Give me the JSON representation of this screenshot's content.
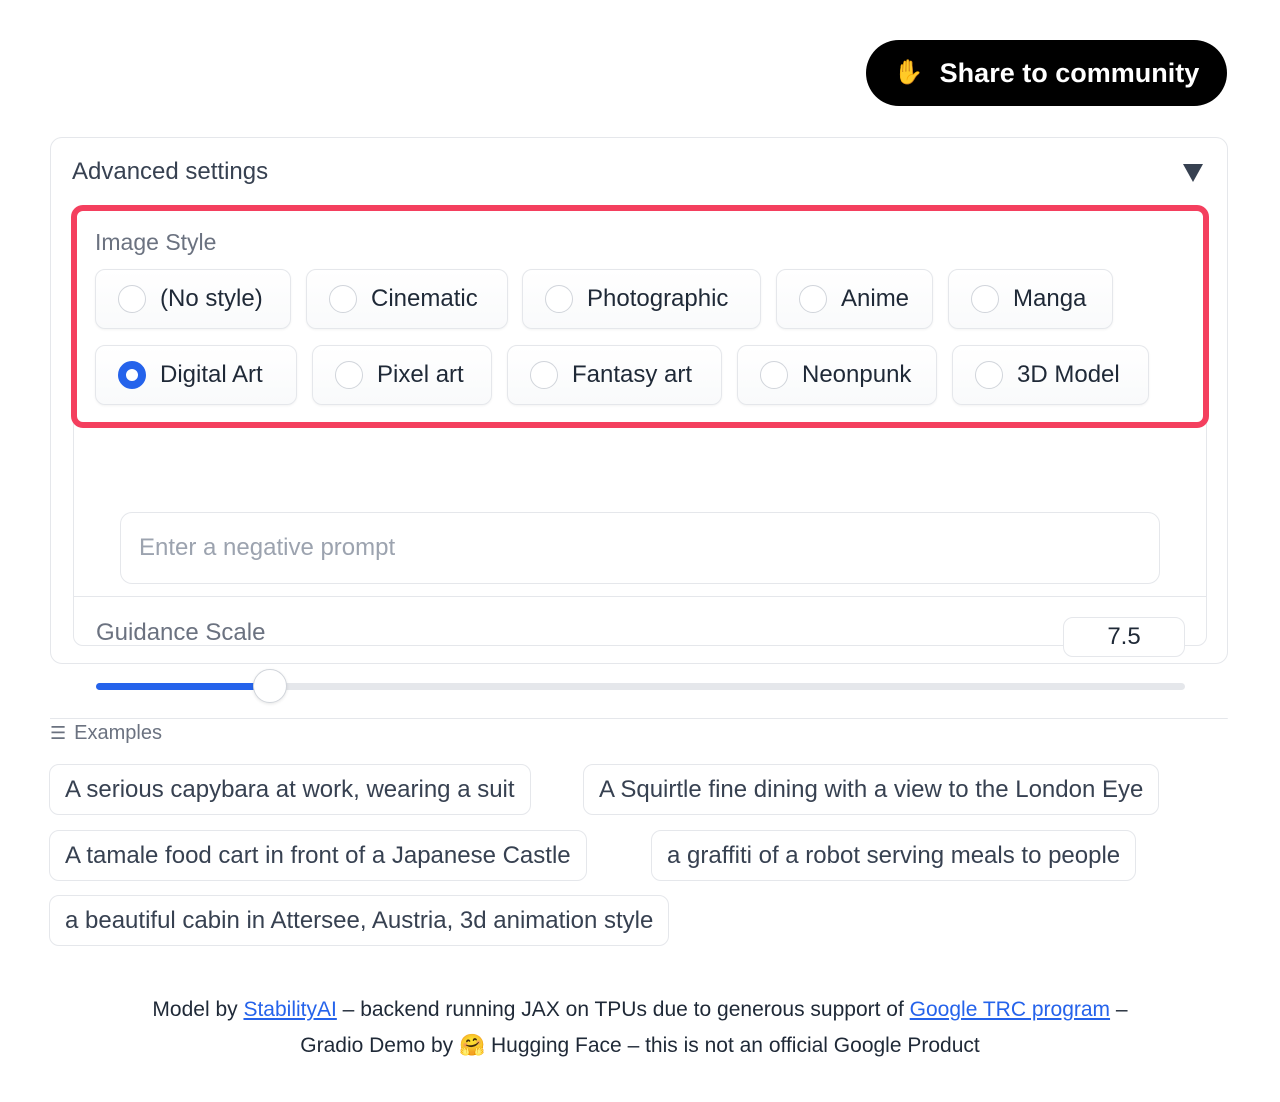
{
  "header": {
    "share_button": {
      "icon": "clapping-hands-icon",
      "label": "Share to community"
    }
  },
  "advanced_settings": {
    "title": "Advanced settings",
    "expanded": true,
    "image_style": {
      "label": "Image Style",
      "selected": "Digital Art",
      "options": [
        "(No style)",
        "Cinematic",
        "Photographic",
        "Anime",
        "Manga",
        "Digital Art",
        "Pixel art",
        "Fantasy art",
        "Neonpunk",
        "3D Model"
      ]
    },
    "negative_prompt": {
      "value": "",
      "placeholder": "Enter a negative prompt"
    },
    "guidance_scale": {
      "label": "Guidance Scale",
      "value": "7.5",
      "fraction": 0.16
    }
  },
  "examples": {
    "label": "Examples",
    "items": [
      "A serious capybara at work, wearing a suit",
      "A Squirtle fine dining with a view to the London Eye",
      "A tamale food cart in front of a Japanese Castle",
      "a graffiti of a robot serving meals to people",
      "a beautiful cabin in Attersee, Austria, 3d animation style"
    ]
  },
  "footer": {
    "line1_prefix": "Model by ",
    "link1": "StabilityAI",
    "line1_middle": " – backend running JAX on TPUs due to generous support of ",
    "link2": "Google TRC program",
    "line1_suffix": " –",
    "line2_prefix": "Gradio Demo by ",
    "hugging_emoji": "🤗",
    "line2_suffix": " Hugging Face – this is not an official Google Product"
  },
  "colors": {
    "accent": "#2563eb",
    "highlight_border": "#f43f5e",
    "share_button_bg": "#000000"
  }
}
